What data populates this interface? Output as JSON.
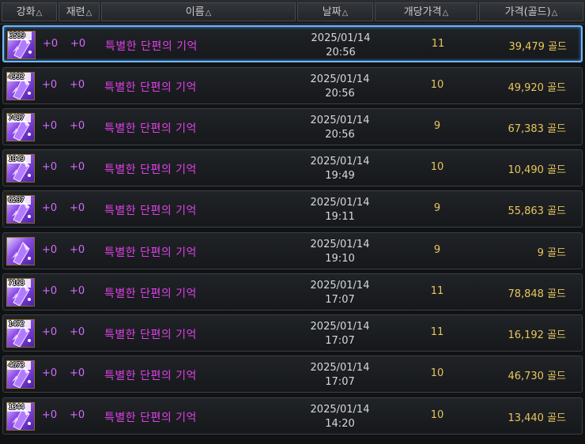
{
  "columns": [
    {
      "label": "강화",
      "sort_icon": "△"
    },
    {
      "label": "재련",
      "sort_icon": "△"
    },
    {
      "label": "이름",
      "sort_icon": "△"
    },
    {
      "label": "날짜",
      "sort_icon": "△"
    },
    {
      "label": "개당가격",
      "sort_icon": "△"
    },
    {
      "label": "가격(골드)",
      "sort_icon": "△"
    }
  ],
  "rows": [
    {
      "count": "3589",
      "enhance": "+0",
      "refine": "+0",
      "name": "특별한 단편의 기억",
      "date": "2025/01/14",
      "time": "20:56",
      "unit_price": "11",
      "price": "39,479",
      "currency": "골드",
      "selected": true
    },
    {
      "count": "4992",
      "enhance": "+0",
      "refine": "+0",
      "name": "특별한 단편의 기억",
      "date": "2025/01/14",
      "time": "20:56",
      "unit_price": "10",
      "price": "49,920",
      "currency": "골드"
    },
    {
      "count": "7487",
      "enhance": "+0",
      "refine": "+0",
      "name": "특별한 단편의 기억",
      "date": "2025/01/14",
      "time": "20:56",
      "unit_price": "9",
      "price": "67,383",
      "currency": "골드"
    },
    {
      "count": "1049",
      "enhance": "+0",
      "refine": "+0",
      "name": "특별한 단편의 기억",
      "date": "2025/01/14",
      "time": "19:49",
      "unit_price": "10",
      "price": "10,490",
      "currency": "골드"
    },
    {
      "count": "6207",
      "enhance": "+0",
      "refine": "+0",
      "name": "특별한 단편의 기억",
      "date": "2025/01/14",
      "time": "19:11",
      "unit_price": "9",
      "price": "55,863",
      "currency": "골드"
    },
    {
      "count": "",
      "enhance": "+0",
      "refine": "+0",
      "name": "특별한 단편의 기억",
      "date": "2025/01/14",
      "time": "19:10",
      "unit_price": "9",
      "price": "9",
      "currency": "골드"
    },
    {
      "count": "7168",
      "enhance": "+0",
      "refine": "+0",
      "name": "특별한 단편의 기억",
      "date": "2025/01/14",
      "time": "17:07",
      "unit_price": "11",
      "price": "78,848",
      "currency": "골드"
    },
    {
      "count": "1472",
      "enhance": "+0",
      "refine": "+0",
      "name": "특별한 단편의 기억",
      "date": "2025/01/14",
      "time": "17:07",
      "unit_price": "11",
      "price": "16,192",
      "currency": "골드"
    },
    {
      "count": "4673",
      "enhance": "+0",
      "refine": "+0",
      "name": "특별한 단편의 기억",
      "date": "2025/01/14",
      "time": "17:07",
      "unit_price": "10",
      "price": "46,730",
      "currency": "골드"
    },
    {
      "count": "1344",
      "enhance": "+0",
      "refine": "+0",
      "name": "특별한 단편의 기억",
      "date": "2025/01/14",
      "time": "14:20",
      "unit_price": "10",
      "price": "13,440",
      "currency": "골드"
    }
  ],
  "colors": {
    "name_text": "#e040e8",
    "gold_text": "#e8c65c",
    "selected_border": "#6fb7ff"
  },
  "item_icon": "purple-crystal-shard-icon"
}
